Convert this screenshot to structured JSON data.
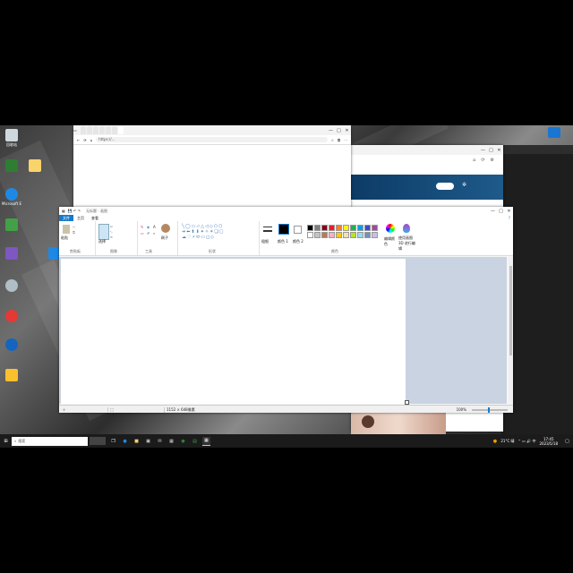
{
  "desktop": {
    "icons": [
      {
        "label": "回收站",
        "color": "#cfd8dc"
      },
      {
        "label": "",
        "color": "#2e7d32"
      },
      {
        "label": "Microsoft Edge",
        "color": "#1e88e5"
      },
      {
        "label": "",
        "color": "#43a047"
      },
      {
        "label": "",
        "color": "#7e57c2"
      },
      {
        "label": "",
        "color": "#b0bec5"
      },
      {
        "label": "",
        "color": "#e53935"
      },
      {
        "label": "",
        "color": "#1565c0"
      },
      {
        "label": "",
        "color": "#fbc02d"
      }
    ],
    "folder_label": ""
  },
  "browser": {
    "tabs": [
      "",
      "",
      "",
      "",
      "",
      "",
      ""
    ],
    "address": "https://...",
    "controls": {
      "minimize": "—",
      "maximize": "□",
      "close": "✕"
    }
  },
  "side_window": {
    "link_text": "",
    "search_button": ""
  },
  "paint": {
    "title": "无标题 - 画图",
    "menu": {
      "file": "文件",
      "home": "主页",
      "view": "查看"
    },
    "groups": {
      "clipboard": "剪贴板",
      "image": "图像",
      "tools": "工具",
      "shapes": "形状",
      "colors": "颜色"
    },
    "buttons": {
      "paste": "粘贴",
      "select": "选择",
      "brushes": "刷子",
      "size": "粗细",
      "color1": "颜色 1",
      "color2": "颜色 2",
      "edit_colors": "编辑颜色",
      "paint3d": "使用画图 3D 进行编辑"
    },
    "palette": [
      "#000000",
      "#7f7f7f",
      "#880015",
      "#ed1c24",
      "#ff7f27",
      "#fff200",
      "#22b14c",
      "#00a2e8",
      "#3f48cc",
      "#a349a4",
      "#ffffff",
      "#c3c3c3",
      "#b97a57",
      "#ffaec9",
      "#ffc90e",
      "#efe4b0",
      "#b5e61d",
      "#99d9ea",
      "#7092be",
      "#c8bfe7"
    ],
    "status": {
      "canvas_size": "1152 × 648像素",
      "zoom": "100%"
    }
  },
  "taskbar": {
    "search_placeholder": "搜索",
    "weather": "21°C 晴",
    "time": "17:45",
    "date": "2023/5/18"
  }
}
